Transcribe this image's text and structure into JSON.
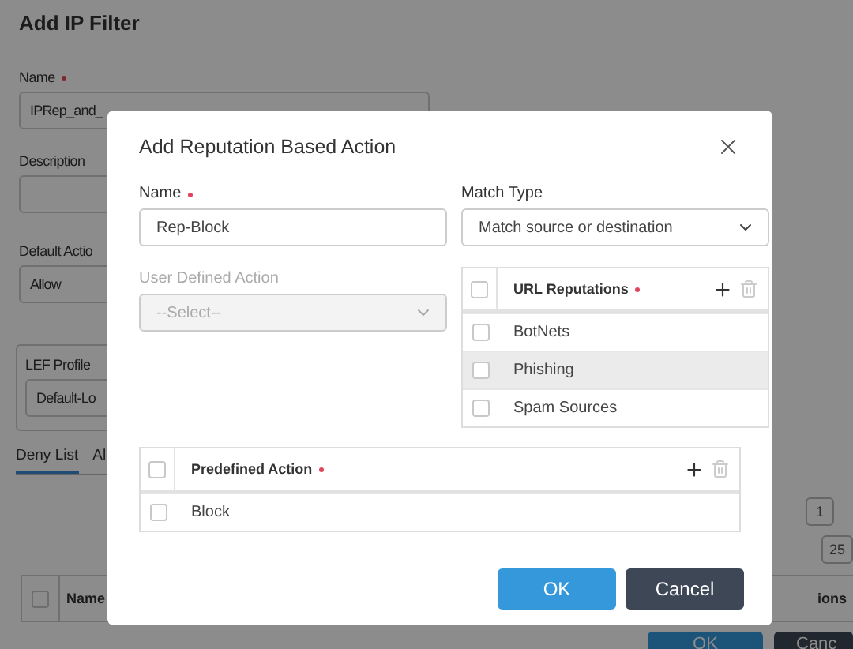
{
  "page": {
    "title": "Add IP Filter",
    "name_field": {
      "label": "Name",
      "required": true,
      "value": "IPRep_and_"
    },
    "description_field": {
      "label": "Description"
    },
    "default_action": {
      "label": "Default Actio",
      "value": "Allow"
    },
    "lef_profile": {
      "label": "LEF Profile",
      "value": "Default-Lo"
    },
    "tabs": [
      {
        "label": "Deny List",
        "selected": true
      },
      {
        "label": "Al",
        "selected": false
      }
    ],
    "pagination": {
      "page": "1",
      "page_size": "25"
    },
    "table": {
      "all_checked": false,
      "columns": [
        "Name",
        "ions"
      ]
    },
    "buttons": [
      {
        "label": "OK",
        "kind": "primary"
      },
      {
        "label": "Canc",
        "kind": "secondary"
      }
    ]
  },
  "modal": {
    "title": "Add Reputation Based Action",
    "name_field": {
      "label": "Name",
      "required": true,
      "value": "Rep-Block"
    },
    "match_type": {
      "label": "Match Type",
      "value": "Match source or destination"
    },
    "user_defined_action": {
      "label": "User Defined Action",
      "placeholder": "--Select--",
      "disabled": true
    },
    "url_reputations": {
      "header": "URL Reputations",
      "required": true,
      "all_checked": false,
      "rows": [
        {
          "label": "BotNets",
          "checked": false,
          "highlighted": false
        },
        {
          "label": "Phishing",
          "checked": false,
          "highlighted": true
        },
        {
          "label": "Spam Sources",
          "checked": false,
          "highlighted": false
        }
      ]
    },
    "predefined_action": {
      "header": "Predefined Action",
      "required": true,
      "all_checked": false,
      "rows": [
        {
          "label": "Block",
          "checked": false,
          "highlighted": false
        }
      ]
    },
    "buttons": [
      {
        "label": "OK",
        "kind": "primary"
      },
      {
        "label": "Cancel",
        "kind": "secondary"
      }
    ]
  }
}
